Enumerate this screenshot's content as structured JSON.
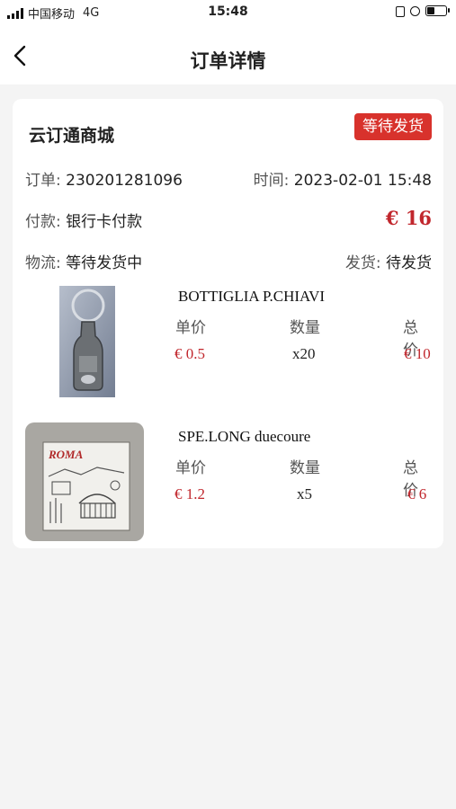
{
  "status_bar": {
    "carrier": "中国移动",
    "network": "4G",
    "time": "15:48"
  },
  "nav": {
    "title": "订单详情"
  },
  "order": {
    "shop_name": "云订通商城",
    "status": "等待发货",
    "order_no_label": "订单:",
    "order_no": "230201281096",
    "time_label": "时间:",
    "time": "2023-02-01 15:48",
    "payment_label": "付款:",
    "payment": "银行卡付款",
    "total": "€ 16",
    "logistics_label": "物流:",
    "logistics": "等待发货中",
    "shipping_label": "发货:",
    "shipping": "待发货"
  },
  "columns": {
    "unit_price": "单价",
    "quantity": "数量",
    "total": "总价"
  },
  "items": [
    {
      "name": "BOTTIGLIA P.CHIAVI",
      "unit_price": "€ 0.5",
      "quantity": "x20",
      "total": "€ 10"
    },
    {
      "name": "SPE.LONG duecoure",
      "unit_price": "€ 1.2",
      "quantity": "x5",
      "total": "€ 6",
      "image_text": "ROMA"
    }
  ],
  "colors": {
    "accent": "#d8322c",
    "price": "#c1272d",
    "background": "#f4f4f4"
  }
}
